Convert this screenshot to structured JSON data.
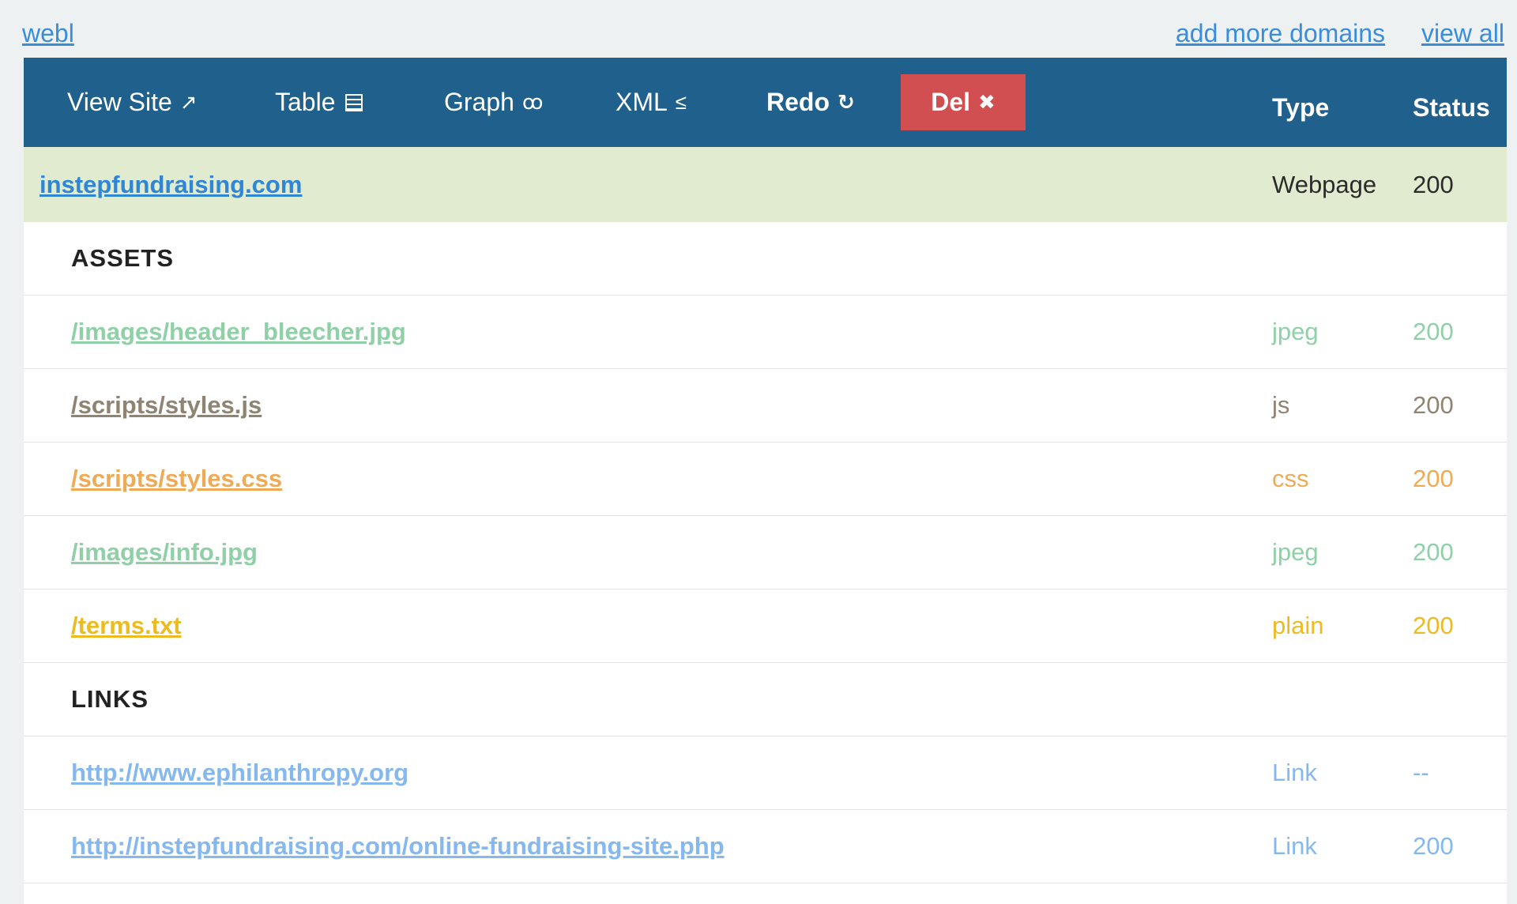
{
  "top_links": {
    "home": "webl",
    "add_domains": "add more domains",
    "view_all": "view all"
  },
  "toolbar": {
    "view_site": "View Site",
    "view_site_icon": "↗",
    "table": "Table",
    "graph": "Graph",
    "graph_icon": "ꝏ",
    "xml": "XML",
    "xml_icon": "≤",
    "redo": "Redo",
    "redo_icon": "↻",
    "del": "Del",
    "del_icon": "✖",
    "type_header": "Type",
    "status_header": "Status"
  },
  "domain": {
    "url": "instepfundraising.com",
    "type": "Webpage",
    "status": "200"
  },
  "sections": {
    "assets": "ASSETS",
    "links": "LINKS"
  },
  "assets": [
    {
      "url": "/images/header_bleecher.jpg",
      "type": "jpeg",
      "status": "200",
      "color": "#8fd0a6"
    },
    {
      "url": "/scripts/styles.js",
      "type": "js",
      "status": "200",
      "color": "#8e8471"
    },
    {
      "url": "/scripts/styles.css",
      "type": "css",
      "status": "200",
      "color": "#eeaa55"
    },
    {
      "url": "/images/info.jpg",
      "type": "jpeg",
      "status": "200",
      "color": "#8fd0a6"
    },
    {
      "url": "/terms.txt",
      "type": "plain",
      "status": "200",
      "color": "#ecbb22"
    }
  ],
  "links": [
    {
      "url": "http://www.ephilanthropy.org",
      "type": "Link",
      "status": "--",
      "color": "#86b8f0"
    },
    {
      "url": "http://instepfundraising.com/online-fundraising-site.php",
      "type": "Link",
      "status": "200",
      "color": "#86b8f0"
    }
  ],
  "colors": {
    "toolbar_bg": "#20608c",
    "del_bg": "#d14f51",
    "domain_row_bg": "#e0ebd0",
    "link_blue": "#3a8ddb"
  }
}
